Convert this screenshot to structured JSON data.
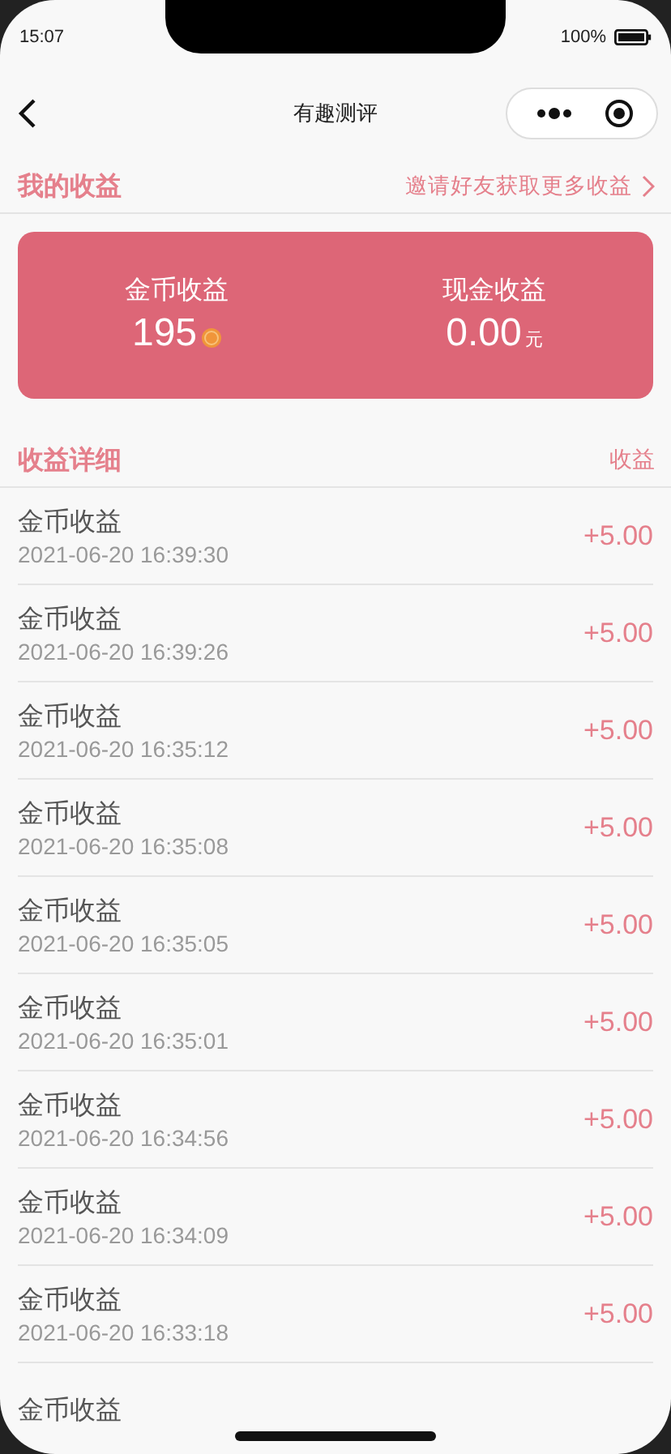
{
  "status_bar": {
    "time": "15:07",
    "battery_text": "100%"
  },
  "nav": {
    "title": "有趣测评"
  },
  "my_earnings": {
    "title": "我的收益",
    "link": "邀请好友获取更多收益"
  },
  "summary": [
    {
      "kind": "coin",
      "label": "金币收益",
      "value": "195"
    },
    {
      "kind": "cash",
      "label": "现金收益",
      "value": "0.00",
      "unit": "元"
    }
  ],
  "details": {
    "title": "收益详细",
    "column": "收益",
    "rows": [
      {
        "name": "金币收益",
        "time": "2021-06-20 16:39:30",
        "amount": "+5.00"
      },
      {
        "name": "金币收益",
        "time": "2021-06-20 16:39:26",
        "amount": "+5.00"
      },
      {
        "name": "金币收益",
        "time": "2021-06-20 16:35:12",
        "amount": "+5.00"
      },
      {
        "name": "金币收益",
        "time": "2021-06-20 16:35:08",
        "amount": "+5.00"
      },
      {
        "name": "金币收益",
        "time": "2021-06-20 16:35:05",
        "amount": "+5.00"
      },
      {
        "name": "金币收益",
        "time": "2021-06-20 16:35:01",
        "amount": "+5.00"
      },
      {
        "name": "金币收益",
        "time": "2021-06-20 16:34:56",
        "amount": "+5.00"
      },
      {
        "name": "金币收益",
        "time": "2021-06-20 16:34:09",
        "amount": "+5.00"
      },
      {
        "name": "金币收益",
        "time": "2021-06-20 16:33:18",
        "amount": "+5.00"
      },
      {
        "name": "金币收益"
      }
    ]
  }
}
